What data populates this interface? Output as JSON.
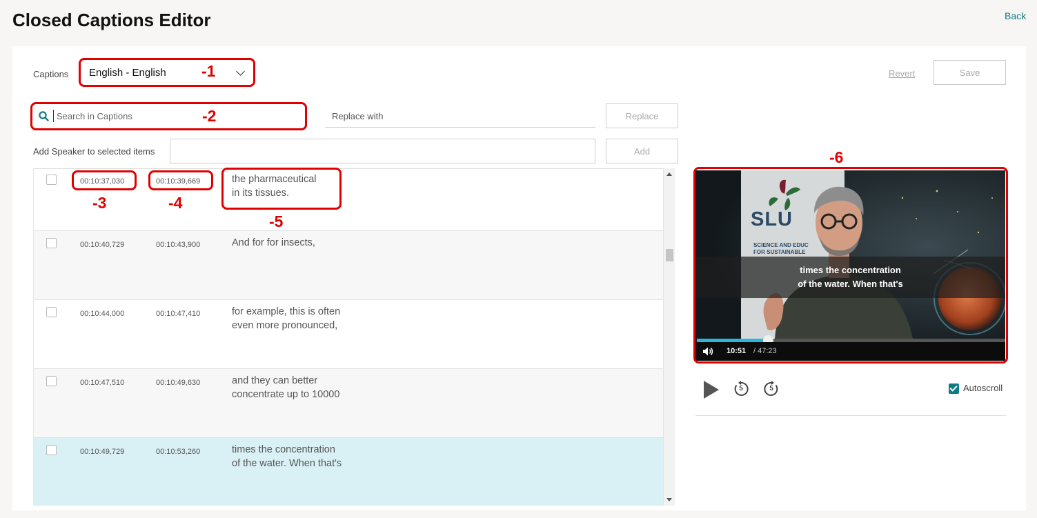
{
  "header": {
    "title": "Closed Captions Editor",
    "back_label": "Back"
  },
  "captions_select": {
    "label": "Captions",
    "value": "English - English"
  },
  "toolbar": {
    "revert_label": "Revert",
    "save_label": "Save"
  },
  "search": {
    "placeholder": "Search in Captions",
    "replace_placeholder": "Replace with",
    "replace_button": "Replace"
  },
  "speaker": {
    "label": "Add Speaker to selected items",
    "add_button": "Add"
  },
  "rows": [
    {
      "start": "00:10:37,030",
      "end": "00:10:39,669",
      "line1": "the pharmaceutical",
      "line2": "in its tissues."
    },
    {
      "start": "00:10:40,729",
      "end": "00:10:43,900",
      "line1": "And for for insects,",
      "line2": ""
    },
    {
      "start": "00:10:44,000",
      "end": "00:10:47,410",
      "line1": "for example, this is often",
      "line2": "even more pronounced,"
    },
    {
      "start": "00:10:47,510",
      "end": "00:10:49,630",
      "line1": "and they can better",
      "line2": "concentrate up to 10000"
    },
    {
      "start": "00:10:49,729",
      "end": "00:10:53,260",
      "line1": "times the concentration",
      "line2": "of the water. When that's"
    }
  ],
  "video": {
    "logo_text": "SLU",
    "banner_line1": "SCIENCE AND EDUC",
    "banner_line2": "FOR SUSTAINABLE",
    "subtitle_line1": "times the concentration",
    "subtitle_line2": "of the water. When that's",
    "current_time": "10:51",
    "duration": "/ 47:23",
    "progress": 0.23
  },
  "player_controls": {
    "skip_back_label": "5",
    "skip_forward_label": "5",
    "autoscroll_label": "Autoscroll",
    "autoscroll_checked": true
  },
  "annotations": [
    "-1",
    "-2",
    "-3",
    "-4",
    "-5",
    "-6"
  ],
  "colors": {
    "accent": "#0e7c86",
    "annotation": "#e00000",
    "active_row": "#d9f0f5",
    "alt_row": "#f7f7f7",
    "progress": "#2fb5d9"
  }
}
